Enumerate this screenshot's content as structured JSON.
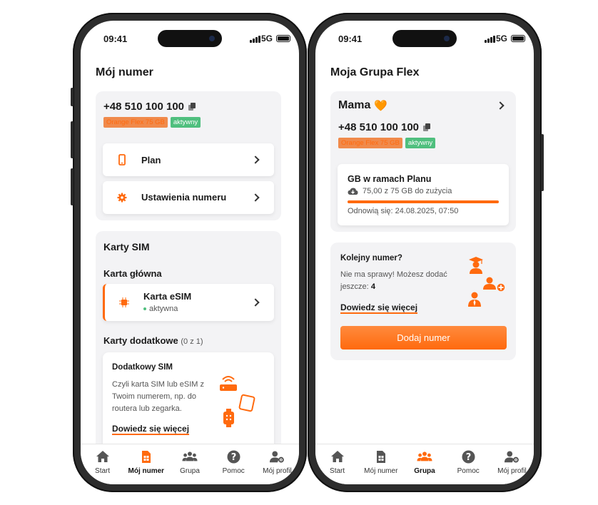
{
  "status": {
    "time": "09:41",
    "network": "5G"
  },
  "left": {
    "title": "Mój numer",
    "phone_number": "+48 510 100 100",
    "badge_plan": "Orange Flex 75 GB",
    "badge_status": "aktywny",
    "menu": [
      {
        "label": "Plan"
      },
      {
        "label": "Ustawienia numeru"
      }
    ],
    "sim_section_title": "Karty SIM",
    "main_card_title": "Karta główna",
    "esim_label": "Karta eSIM",
    "esim_status": "aktywna",
    "extra_title": "Karty dodatkowe",
    "extra_count": "(0 z 1)",
    "extra_card_title": "Dodatkowy SIM",
    "extra_card_desc": "Czyli karta SIM lub eSIM z Twoim numerem, np. do routera lub zegarka.",
    "extra_card_link": "Dowiedz się więcej"
  },
  "right": {
    "title": "Moja Grupa Flex",
    "member_name": "Mama",
    "member_emoji": "🧡",
    "phone_number": "+48 510 100 100",
    "badge_plan": "Orange Flex 75 GB",
    "badge_status": "aktywny",
    "data_title": "GB w ramach Planu",
    "data_usage": "75,00 z 75 GB do zużycia",
    "data_fill_fraction": 1.0,
    "renewal": "Odnowią się: 24.08.2025, 07:50",
    "next_title": "Kolejny numer?",
    "next_desc": "Nie ma sprawy! Możesz dodać jeszcze:",
    "next_count": "4",
    "next_link": "Dowiedz się więcej",
    "add_button": "Dodaj numer"
  },
  "tabs": [
    {
      "label": "Start",
      "icon": "home-icon"
    },
    {
      "label": "Mój numer",
      "icon": "sim-card-icon"
    },
    {
      "label": "Grupa",
      "icon": "group-icon"
    },
    {
      "label": "Pomoc",
      "icon": "help-icon"
    },
    {
      "label": "Mój profil",
      "icon": "profile-settings-icon"
    }
  ],
  "colors": {
    "accent": "#ff6a0e",
    "badge_orange": "#f08a4b",
    "badge_green": "#4fbf7e",
    "card_bg": "#f3f3f5"
  }
}
